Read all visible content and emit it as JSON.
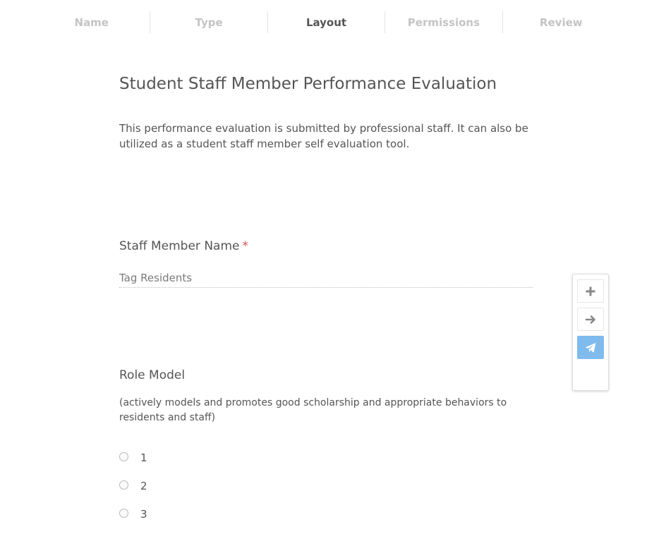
{
  "wizard": {
    "steps": [
      {
        "label": "Name",
        "active": false
      },
      {
        "label": "Type",
        "active": false
      },
      {
        "label": "Layout",
        "active": true
      },
      {
        "label": "Permissions",
        "active": false
      },
      {
        "label": "Review",
        "active": false
      }
    ]
  },
  "form": {
    "title": "Student Staff Member Performance Evaluation",
    "description": "This performance evaluation is submitted by professional staff. It can also be utilized as a student staff member self evaluation tool."
  },
  "staff_field": {
    "label": "Staff Member Name",
    "required_marker": "*",
    "placeholder": "Tag Residents"
  },
  "role_model": {
    "label": "Role Model",
    "help": "(actively models and promotes good scholarship and appropriate behaviors to residents and staff)",
    "options": [
      "1",
      "2",
      "3"
    ]
  },
  "toolbar": {
    "buttons": [
      {
        "icon": "plus-icon"
      },
      {
        "icon": "arrow-right-icon"
      },
      {
        "icon": "paper-plane-icon"
      }
    ]
  },
  "colors": {
    "text": "#555555",
    "inactive_step": "#c4c4c4",
    "required": "#d9534f",
    "primary_button": "#7fbbed",
    "icon": "#888888"
  }
}
